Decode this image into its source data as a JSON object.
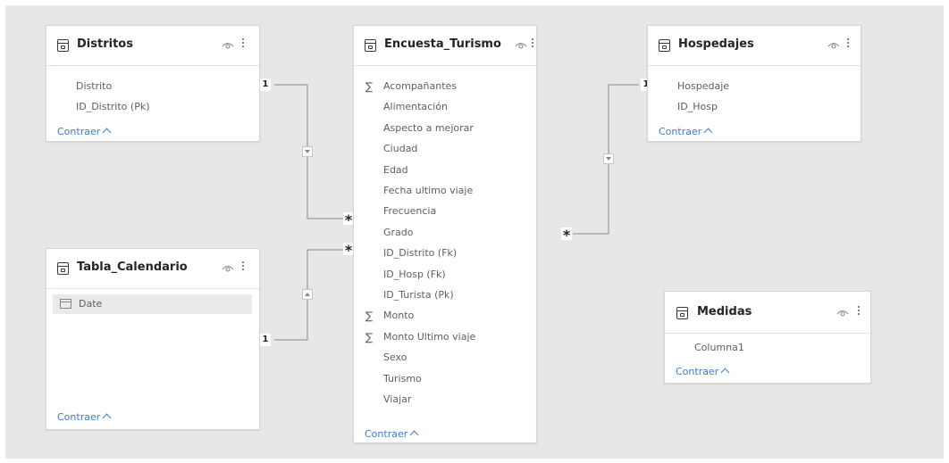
{
  "tables": {
    "distritos": {
      "title": "Distritos",
      "fields": [
        "Distrito",
        "ID_Distrito (Pk)"
      ],
      "collapse_label": "Contraer"
    },
    "encuesta": {
      "title": "Encuesta_Turismo",
      "fields": [
        {
          "name": "Acompañantes",
          "sigma": "∑"
        },
        {
          "name": "Alimentación",
          "sigma": ""
        },
        {
          "name": "Aspecto a mejorar",
          "sigma": ""
        },
        {
          "name": "Ciudad",
          "sigma": ""
        },
        {
          "name": "Edad",
          "sigma": ""
        },
        {
          "name": "Fecha ultimo viaje",
          "sigma": ""
        },
        {
          "name": "Frecuencia",
          "sigma": ""
        },
        {
          "name": "Grado",
          "sigma": ""
        },
        {
          "name": "ID_Distrito (Fk)",
          "sigma": ""
        },
        {
          "name": "ID_Hosp (Fk)",
          "sigma": ""
        },
        {
          "name": "ID_Turista (Pk)",
          "sigma": ""
        },
        {
          "name": "Monto",
          "sigma": "∑"
        },
        {
          "name": "Monto Ultimo viaje",
          "sigma": "∑"
        },
        {
          "name": "Sexo",
          "sigma": ""
        },
        {
          "name": "Turismo",
          "sigma": ""
        },
        {
          "name": "Viajar",
          "sigma": ""
        }
      ],
      "collapse_label": "Contraer"
    },
    "hospedajes": {
      "title": "Hospedajes",
      "fields": [
        "Hospedaje",
        "ID_Hosp"
      ],
      "collapse_label": "Contraer"
    },
    "calendario": {
      "title": "Tabla_Calendario",
      "fields": [
        "Date"
      ],
      "collapse_label": "Contraer"
    },
    "medidas": {
      "title": "Medidas",
      "fields": [
        "Columna1"
      ],
      "collapse_label": "Contraer"
    }
  },
  "relationships": {
    "distritos": {
      "one": "1",
      "many": "*"
    },
    "hospedajes": {
      "one": "1",
      "many": "*"
    },
    "calendario": {
      "one": "1",
      "many": "*"
    }
  },
  "colors": {
    "link": "#3a7bd5",
    "canvas": "#e9e7e5",
    "line": "#8a8886"
  },
  "icons": {
    "table": "table-icon",
    "visibility": "eye-icon",
    "more": "more-options-icon",
    "sum": "sigma-icon",
    "calendar": "calendar-icon"
  }
}
